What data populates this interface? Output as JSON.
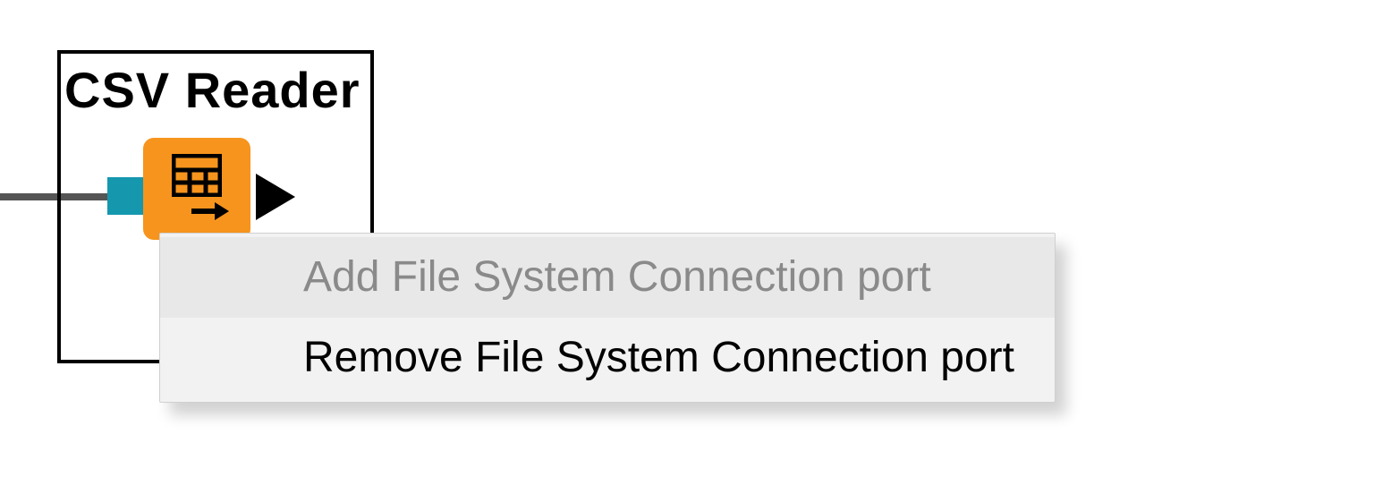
{
  "node": {
    "title": "CSV Reader"
  },
  "contextMenu": {
    "items": [
      {
        "label": "Add File System Connection port",
        "enabled": false
      },
      {
        "label": "Remove File System Connection port",
        "enabled": true
      }
    ]
  }
}
